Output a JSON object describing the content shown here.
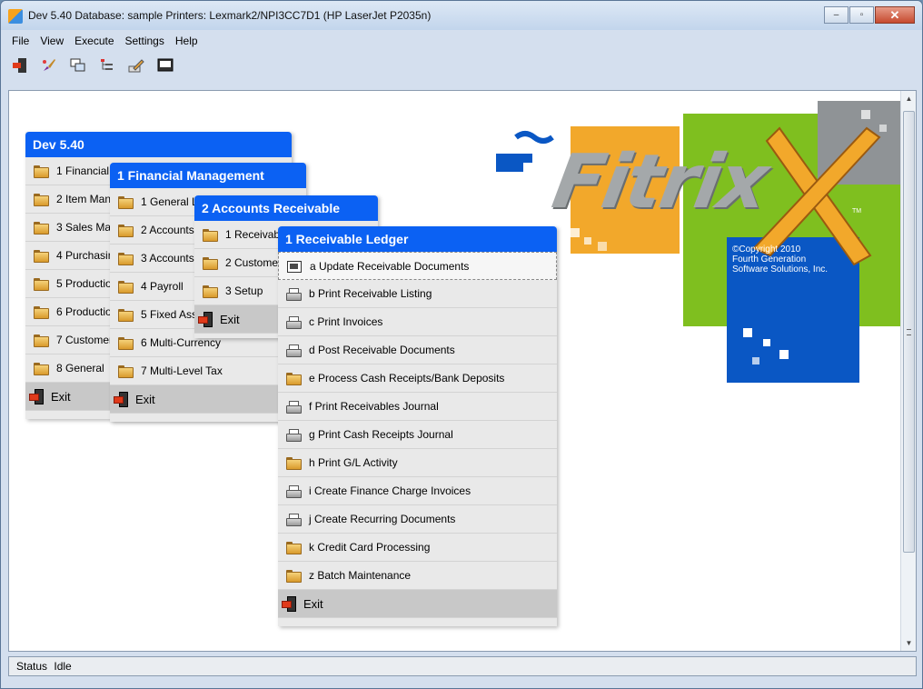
{
  "window": {
    "title": "Dev 5.40 Database: sample Printers: Lexmark2/NPI3CC7D1 (HP LaserJet P2035n)",
    "minimize": "–",
    "maximize": "▫",
    "close": "✕"
  },
  "menubar": [
    "File",
    "View",
    "Execute",
    "Settings",
    "Help"
  ],
  "toolbar": [
    {
      "icon": "exit-icon"
    },
    {
      "icon": "brush-icon"
    },
    {
      "icon": "windows-icon"
    },
    {
      "icon": "tree-icon"
    },
    {
      "icon": "pencil-icon"
    },
    {
      "icon": "terminal-icon"
    }
  ],
  "menus": {
    "dev": {
      "title": "Dev 5.40",
      "items": [
        "1 Financial Management",
        "2 Item Management",
        "3 Sales Management",
        "4 Purchasing",
        "5 Production",
        "6 Production",
        "7 Customer",
        "8 General"
      ],
      "exit": "Exit"
    },
    "financial": {
      "title": "1 Financial Management",
      "items": [
        "1 General Ledger",
        "2 Accounts Receivable",
        "3 Accounts Payable",
        "4 Payroll",
        "5 Fixed Assets",
        "6 Multi-Currency",
        "7 Multi-Level Tax"
      ],
      "exit": "Exit"
    },
    "ar": {
      "title": "2 Accounts Receivable",
      "items": [
        "1 Receivable Ledger",
        "2 Customer",
        "3 Setup"
      ],
      "exit": "Exit"
    },
    "ledger": {
      "title": "1 Receivable Ledger",
      "items": [
        {
          "label": "a  Update Receivable Documents",
          "icon": "screen-icon"
        },
        {
          "label": "b  Print Receivable Listing",
          "icon": "printer-icon"
        },
        {
          "label": "c  Print Invoices",
          "icon": "printer-icon"
        },
        {
          "label": "d  Post Receivable Documents",
          "icon": "printer-icon"
        },
        {
          "label": "e  Process Cash Receipts/Bank Deposits",
          "icon": "folder-icon"
        },
        {
          "label": "f  Print Receivables Journal",
          "icon": "printer-icon"
        },
        {
          "label": "g  Print Cash Receipts Journal",
          "icon": "printer-icon"
        },
        {
          "label": "h  Print G/L Activity",
          "icon": "folder-icon"
        },
        {
          "label": "i  Create Finance Charge Invoices",
          "icon": "printer-icon"
        },
        {
          "label": "j  Create Recurring Documents",
          "icon": "printer-icon"
        },
        {
          "label": "k  Credit Card Processing",
          "icon": "folder-icon"
        },
        {
          "label": "z  Batch Maintenance",
          "icon": "folder-icon"
        }
      ],
      "exit": "Exit"
    }
  },
  "logo": {
    "wordmark": "Fitrix",
    "tm": "TM",
    "copyright_line1": "©Copyright 2010",
    "copyright_line2": "Fourth Generation",
    "copyright_line3": "Software Solutions, Inc."
  },
  "status": {
    "label": "Status",
    "value": "Idle"
  },
  "colors": {
    "menu_header": "#0b61f3",
    "logo_orange": "#f2a82b",
    "logo_green": "#7fbf1f",
    "logo_blue": "#0a57c4",
    "logo_gray": "#8f9396"
  }
}
